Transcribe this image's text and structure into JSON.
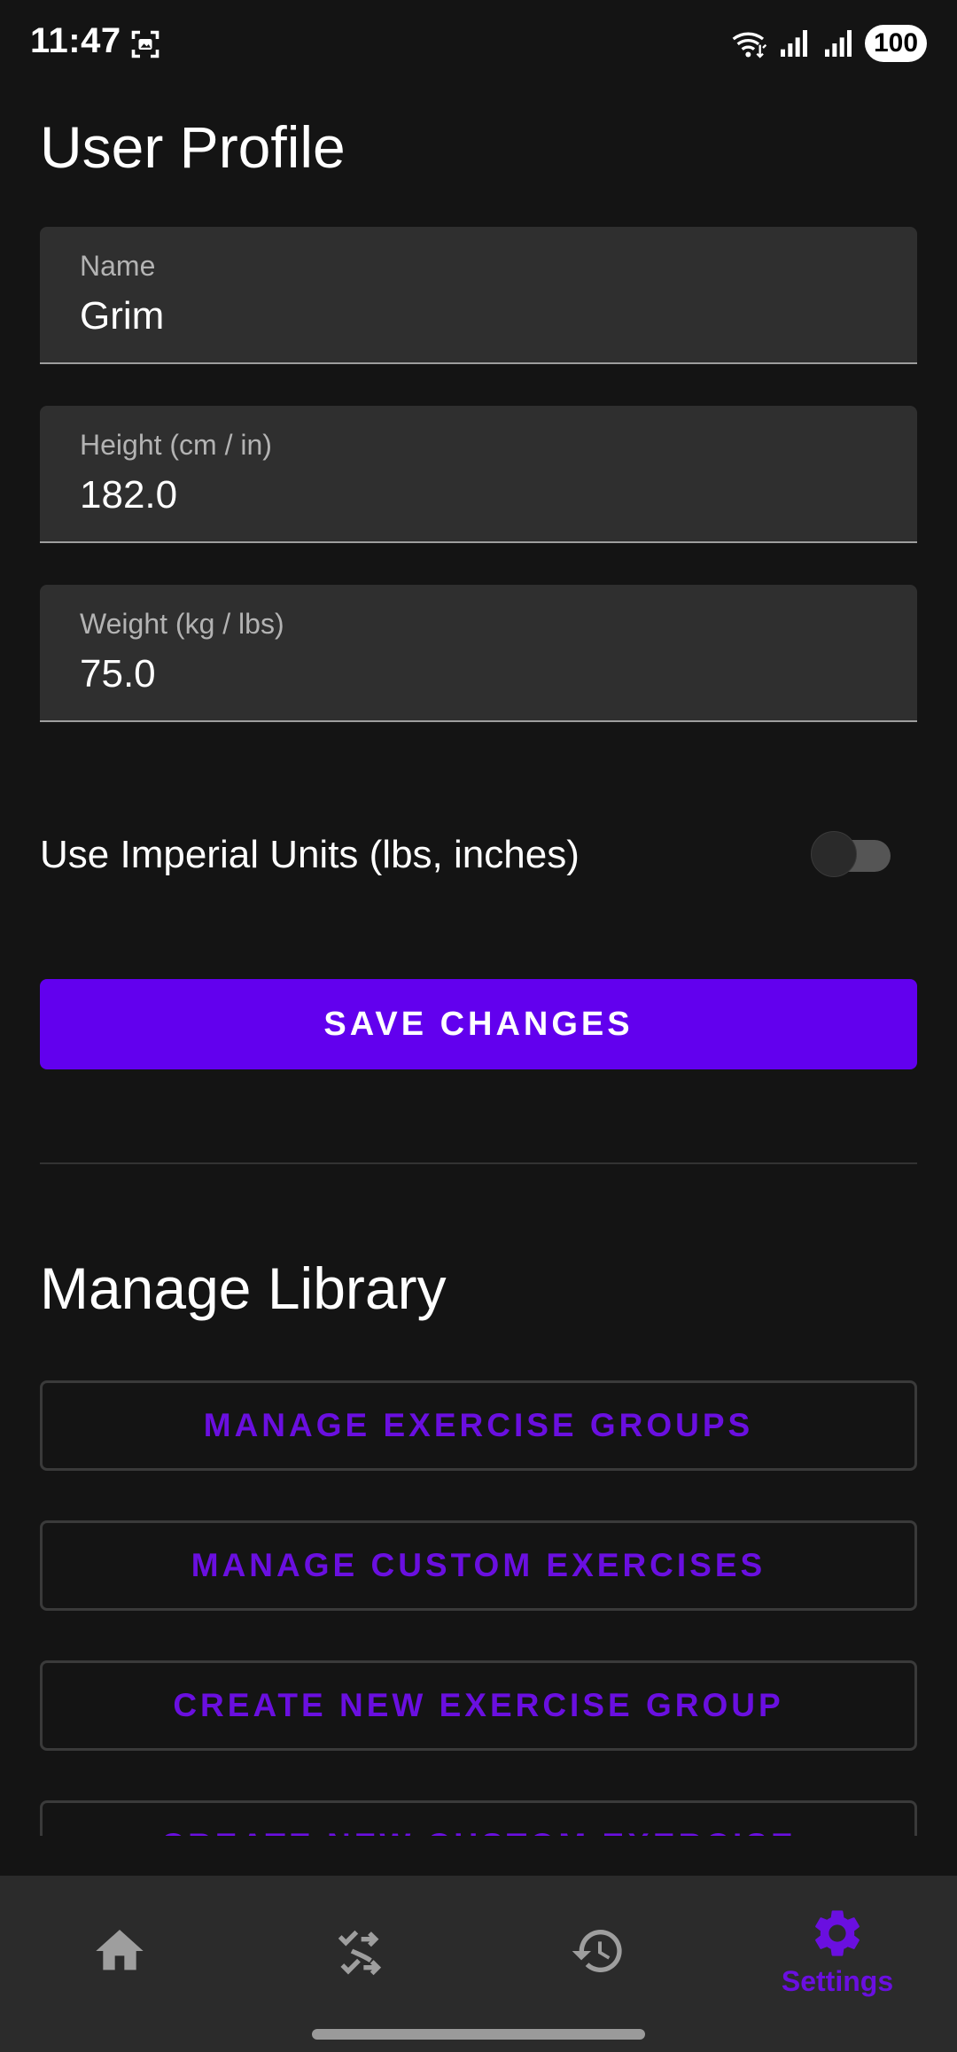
{
  "status_bar": {
    "time": "11:47",
    "battery": "100",
    "icons": [
      "screenshot-icon",
      "wifi-icon",
      "signal-icon",
      "signal-icon"
    ]
  },
  "profile": {
    "title": "User Profile",
    "name_label": "Name",
    "name_value": "Grim",
    "height_label": "Height (cm / in)",
    "height_value": "182.0",
    "weight_label": "Weight (kg / lbs)",
    "weight_value": "75.0",
    "imperial_label": "Use Imperial Units (lbs, inches)",
    "imperial_enabled": false,
    "save_label": "SAVE CHANGES"
  },
  "library": {
    "title": "Manage Library",
    "buttons": [
      "MANAGE EXERCISE GROUPS",
      "MANAGE CUSTOM EXERCISES",
      "CREATE NEW EXERCISE GROUP",
      "CREATE NEW CUSTOM EXERCISE"
    ]
  },
  "nav": {
    "items": [
      {
        "icon": "home-icon",
        "label": ""
      },
      {
        "icon": "swap-icon",
        "label": ""
      },
      {
        "icon": "history-icon",
        "label": ""
      },
      {
        "icon": "gear-icon",
        "label": "Settings",
        "active": true
      }
    ]
  },
  "colors": {
    "background": "#141414",
    "accent": "#6200ee",
    "field_bg": "#2f2f2f",
    "nav_bg": "#2b2b2b",
    "nav_icon": "#9e9e9e"
  }
}
